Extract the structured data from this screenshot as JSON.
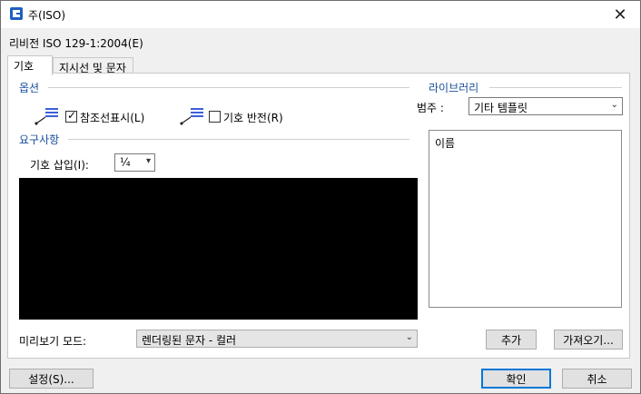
{
  "window": {
    "title": "주(ISO)"
  },
  "header": {
    "revision": "리비전 ISO 129-1:2004(E)"
  },
  "tabs": [
    {
      "label": "기호"
    },
    {
      "label": "지시선 및 문자"
    }
  ],
  "options": {
    "group_label": "옵션",
    "show_reference_line": {
      "label": "참조선표시(L)",
      "checked": true
    },
    "invert_symbol": {
      "label": "기호 반전(R)",
      "checked": false
    }
  },
  "requirements": {
    "group_label": "요구사항",
    "insert_symbol_label": "기호 삽입(I):",
    "insert_symbol_value": "¼"
  },
  "preview": {
    "mode_label": "미리보기 모드:",
    "mode_value": "렌더링된 문자 - 컬러"
  },
  "library": {
    "group_label": "라이브러리",
    "category_label": "범주 :",
    "category_value": "기타 템플릿",
    "list_header": "이름"
  },
  "buttons": {
    "add": "추가",
    "import": "가져오기...",
    "settings": "설정(S)...",
    "ok": "확인",
    "cancel": "취소"
  },
  "colors": {
    "accent": "#0078d7",
    "group_label": "#1a4f9c"
  }
}
